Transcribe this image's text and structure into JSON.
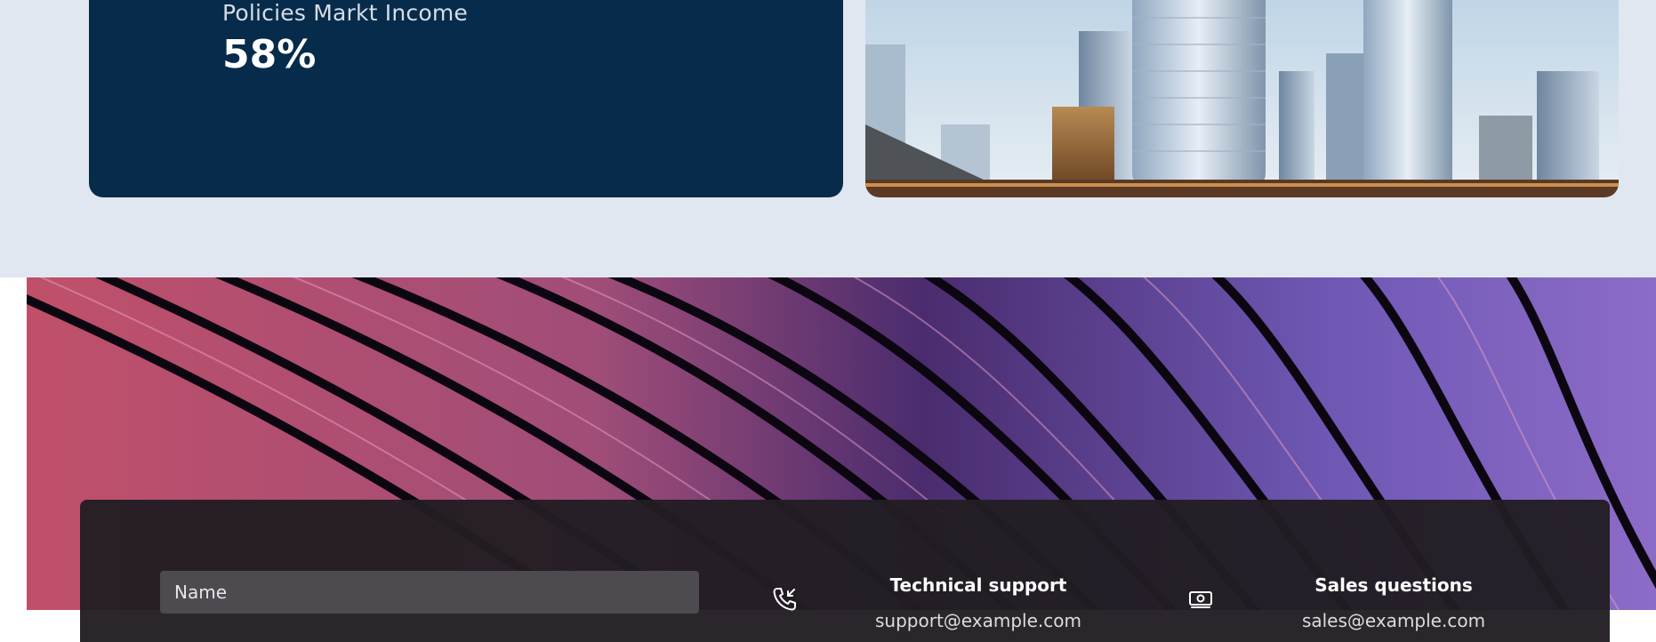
{
  "stats": {
    "label": "Policies Markt Income",
    "value": "58%"
  },
  "contact": {
    "name_placeholder": "Name",
    "support": {
      "title": "Technical support",
      "email": "support@example.com",
      "icon": "phone-incoming-icon"
    },
    "sales": {
      "title": "Sales questions",
      "email": "sales@example.com",
      "icon": "money-icon"
    }
  },
  "colors": {
    "band_background": "#e1e7f0",
    "stat_card": "#072b4a",
    "panel": "#221d23",
    "input": "#4d4b50"
  }
}
